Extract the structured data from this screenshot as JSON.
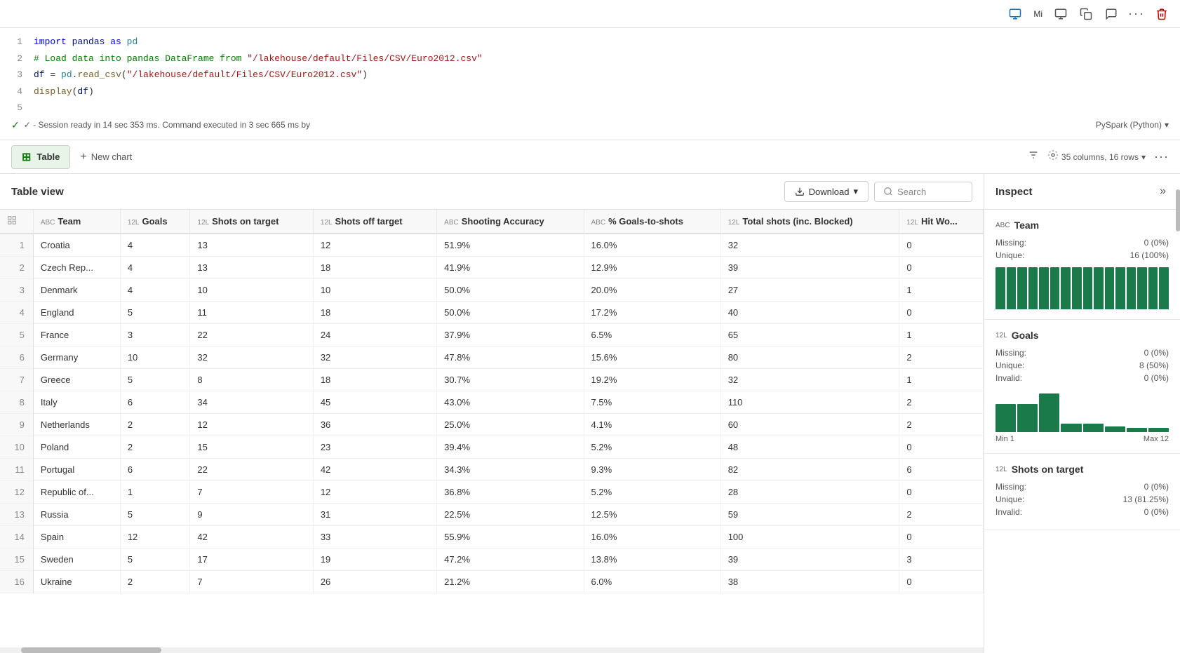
{
  "topToolbar": {
    "userInitial": "Mi",
    "icons": [
      "monitor-icon",
      "copy-icon",
      "chat-icon",
      "more-icon",
      "delete-icon"
    ]
  },
  "codeEditor": {
    "lines": [
      {
        "num": 1,
        "type": "code",
        "tokens": [
          {
            "t": "kw",
            "v": "import"
          },
          {
            "t": "normal",
            "v": " pandas "
          },
          {
            "t": "kw",
            "v": "as"
          },
          {
            "t": "normal",
            "v": " "
          },
          {
            "t": "module",
            "v": "pd"
          }
        ]
      },
      {
        "num": 2,
        "type": "code",
        "text": "# Load data into pandas DataFrame from \"/lakehouse/default/Files/CSV/Euro2012.csv\""
      },
      {
        "num": 3,
        "type": "code",
        "text": "df = pd.read_csv(\"/lakehouse/default/Files/CSV/Euro2012.csv\")"
      },
      {
        "num": 4,
        "type": "code",
        "text": "display(df)"
      },
      {
        "num": 5,
        "type": "empty",
        "text": ""
      }
    ],
    "status": "✓  - Session ready in 14 sec 353 ms. Command executed in 3 sec 665 ms by",
    "language": "PySpark (Python)"
  },
  "tabs": {
    "table": "Table",
    "newChart": "New chart"
  },
  "tableInfo": {
    "columns": "35 columns, 16 rows",
    "title": "Table view"
  },
  "buttons": {
    "download": "Download",
    "search": "Search",
    "inspect": "Inspect"
  },
  "tableHeaders": [
    {
      "type": "ABC",
      "name": "Team"
    },
    {
      "type": "12L",
      "name": "Goals"
    },
    {
      "type": "12L",
      "name": "Shots on target"
    },
    {
      "type": "12L",
      "name": "Shots off target"
    },
    {
      "type": "ABC",
      "name": "Shooting Accuracy"
    },
    {
      "type": "ABC",
      "name": "% Goals-to-shots"
    },
    {
      "type": "12L",
      "name": "Total shots (inc. Blocked)"
    },
    {
      "type": "12L",
      "name": "Hit Wo..."
    }
  ],
  "tableRows": [
    [
      1,
      "Croatia",
      4,
      13,
      12,
      "51.9%",
      "16.0%",
      32,
      0
    ],
    [
      2,
      "Czech Rep...",
      4,
      13,
      18,
      "41.9%",
      "12.9%",
      39,
      0
    ],
    [
      3,
      "Denmark",
      4,
      10,
      10,
      "50.0%",
      "20.0%",
      27,
      1
    ],
    [
      4,
      "England",
      5,
      11,
      18,
      "50.0%",
      "17.2%",
      40,
      0
    ],
    [
      5,
      "France",
      3,
      22,
      24,
      "37.9%",
      "6.5%",
      65,
      1
    ],
    [
      6,
      "Germany",
      10,
      32,
      32,
      "47.8%",
      "15.6%",
      80,
      2
    ],
    [
      7,
      "Greece",
      5,
      8,
      18,
      "30.7%",
      "19.2%",
      32,
      1
    ],
    [
      8,
      "Italy",
      6,
      34,
      45,
      "43.0%",
      "7.5%",
      110,
      2
    ],
    [
      9,
      "Netherlands",
      2,
      12,
      36,
      "25.0%",
      "4.1%",
      60,
      2
    ],
    [
      10,
      "Poland",
      2,
      15,
      23,
      "39.4%",
      "5.2%",
      48,
      0
    ],
    [
      11,
      "Portugal",
      6,
      22,
      42,
      "34.3%",
      "9.3%",
      82,
      6
    ],
    [
      12,
      "Republic of...",
      1,
      7,
      12,
      "36.8%",
      "5.2%",
      28,
      0
    ],
    [
      13,
      "Russia",
      5,
      9,
      31,
      "22.5%",
      "12.5%",
      59,
      2
    ],
    [
      14,
      "Spain",
      12,
      42,
      33,
      "55.9%",
      "16.0%",
      100,
      0
    ],
    [
      15,
      "Sweden",
      5,
      17,
      19,
      "47.2%",
      "13.8%",
      39,
      3
    ],
    [
      16,
      "Ukraine",
      2,
      7,
      26,
      "21.2%",
      "6.0%",
      38,
      0
    ]
  ],
  "inspectPanel": {
    "title": "Inspect",
    "sections": [
      {
        "colName": "Team",
        "colType": "ABC",
        "stats": [
          {
            "label": "Missing:",
            "value": "0 (0%)"
          },
          {
            "label": "Unique:",
            "value": "16 (100%)"
          }
        ],
        "chartBars": [
          60,
          60,
          60,
          60,
          60,
          60,
          60,
          60,
          60,
          60,
          60,
          60,
          60,
          60,
          60,
          60
        ],
        "hasRange": false
      },
      {
        "colName": "Goals",
        "colType": "12L",
        "stats": [
          {
            "label": "Missing:",
            "value": "0 (0%)"
          },
          {
            "label": "Unique:",
            "value": "8 (50%)"
          },
          {
            "label": "Invalid:",
            "value": "0 (0%)"
          }
        ],
        "chartBars": [
          40,
          40,
          55,
          10,
          10,
          5,
          5,
          5
        ],
        "hasRange": true,
        "min": "Min 1",
        "max": "Max 12"
      },
      {
        "colName": "Shots on target",
        "colType": "12L",
        "stats": [
          {
            "label": "Missing:",
            "value": "0 (0%)"
          },
          {
            "label": "Unique:",
            "value": "13 (81.25%)"
          },
          {
            "label": "Invalid:",
            "value": "0 (0%)"
          }
        ],
        "chartBars": [],
        "hasRange": false
      }
    ]
  }
}
